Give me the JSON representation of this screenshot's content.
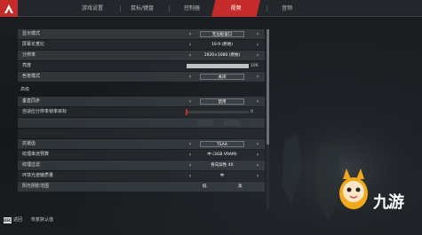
{
  "tabs": [
    {
      "label": "游戏设置",
      "active": false
    },
    {
      "label": "鼠标/键盘",
      "active": false
    },
    {
      "label": "控制器",
      "active": false
    },
    {
      "label": "视频",
      "active": true
    },
    {
      "label": "音频",
      "active": false
    }
  ],
  "settings_top": [
    {
      "label": "显示模式",
      "value": "无边框窗口"
    },
    {
      "label": "屏幕长宽比",
      "value": "16:9 (原始)"
    },
    {
      "label": "分辨率",
      "value": "1920×1080 (原始)"
    },
    {
      "label": "亮度",
      "slider_value": "106"
    },
    {
      "label": "色盲模式",
      "value": "关闭"
    }
  ],
  "section_label": "高级",
  "settings_adv": [
    {
      "label": "垂直同步",
      "value": "禁用"
    },
    {
      "label": "自适应分辨率帧率目标",
      "slider_value": "0"
    },
    {
      "label": "抗锯齿",
      "value": "TSAA"
    },
    {
      "label": "纹理串流预算",
      "value": "中 (3GB VRAM)"
    },
    {
      "label": "纹理过滤",
      "value": "各向异性 4X"
    },
    {
      "label": "环境光遮蔽质量",
      "value": "中"
    },
    {
      "label": "阳光阴影范围",
      "value_low": "低",
      "value_high": "高"
    }
  ],
  "bottom": {
    "esc_key": "ESC",
    "back_label": "返回",
    "reset_label": "恢复默认值"
  },
  "watermark": "九游",
  "colors": {
    "accent": "#c52b2b",
    "row_light": "#464c52",
    "row_dark": "#2d3237"
  }
}
